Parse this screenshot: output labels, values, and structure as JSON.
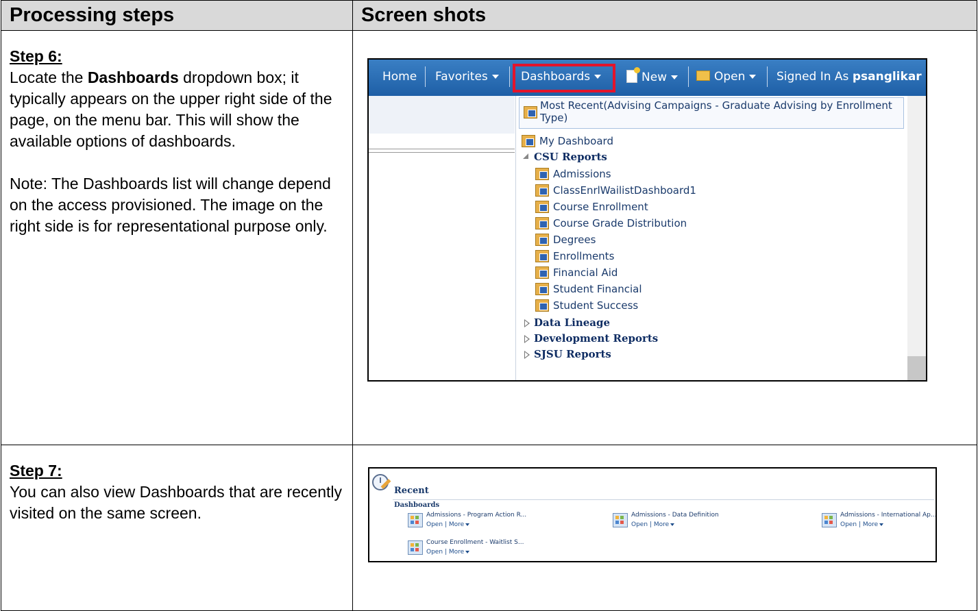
{
  "headers": {
    "left": "Processing steps",
    "right": "Screen shots"
  },
  "step6": {
    "title": "Step 6:",
    "intro_pre": "Locate the ",
    "intro_bold": "Dashboards",
    "intro_post": " dropdown box; it typically appears on the upper right side of the page, on the menu bar. This will show the available options of dashboards.",
    "note": "Note: The Dashboards list will change depend on the access provisioned. The image on the right side is for representational purpose only."
  },
  "step7": {
    "title": "Step 7:",
    "text": "You can also view Dashboards that are recently visited on the same screen."
  },
  "shot1": {
    "nav": {
      "home": "Home",
      "favorites": "Favorites",
      "dashboards": "Dashboards",
      "new": "New",
      "open": "Open",
      "signed_in_as": "Signed In As",
      "user": "psanglikar"
    },
    "menu": {
      "most_recent": "Most Recent(Advising Campaigns - Graduate Advising by Enrollment Type)",
      "my_dashboard": "My Dashboard",
      "group_open": "CSU Reports",
      "items": [
        "Admissions",
        "ClassEnrlWailistDashboard1",
        "Course Enrollment",
        "Course Grade Distribution",
        "Degrees",
        "Enrollments",
        "Financial Aid",
        "Student Financial",
        "Student Success"
      ],
      "groups_closed": [
        "Data Lineage",
        "Development Reports",
        "SJSU Reports"
      ]
    }
  },
  "shot2": {
    "title": "Recent",
    "section": "Dashboards",
    "cards": [
      {
        "title": "Admissions - Program Action R...",
        "open": "Open",
        "more": "More"
      },
      {
        "title": "Admissions - Data Definition",
        "open": "Open",
        "more": "More"
      },
      {
        "title": "Admissions - International Ap...",
        "open": "Open",
        "more": "More"
      },
      {
        "title": "Course Enrollment - Waitlist S...",
        "open": "Open",
        "more": "More"
      }
    ]
  }
}
